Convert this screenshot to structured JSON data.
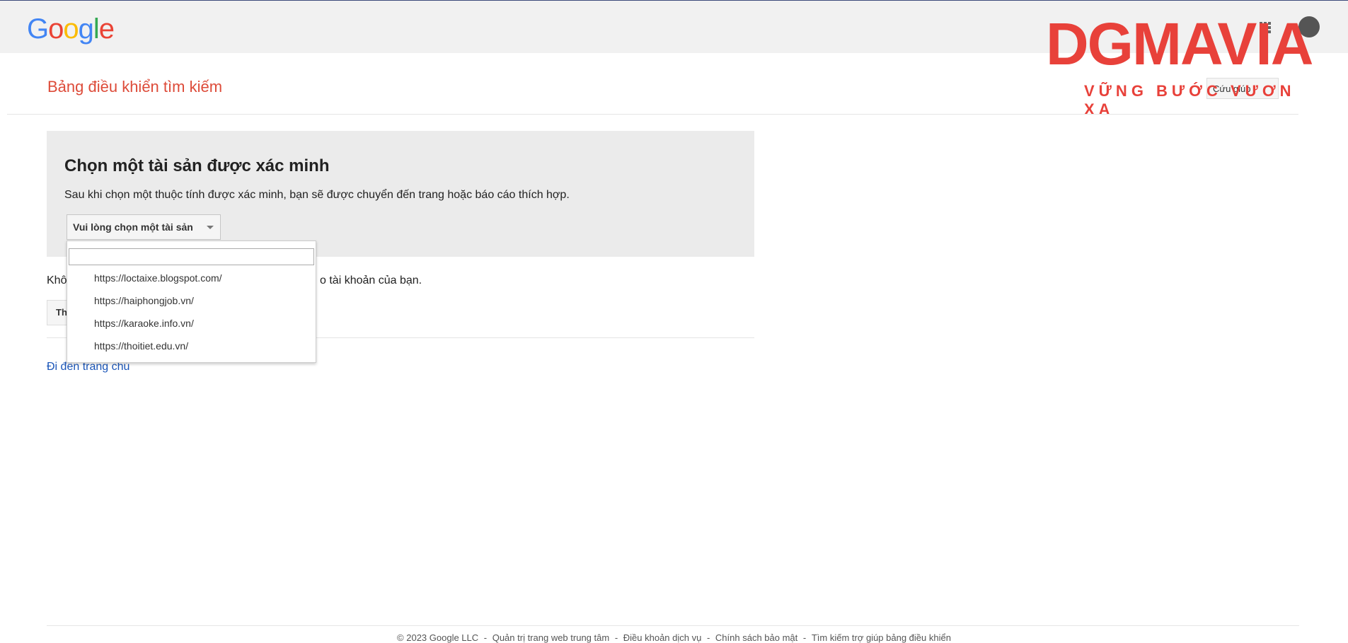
{
  "header": {
    "logo_text": "Google",
    "logo_colors": [
      "#4285F4",
      "#EA4335",
      "#FBBC05",
      "#4285F4",
      "#34A853",
      "#EA4335"
    ]
  },
  "watermark": {
    "main": "DGMAVIA",
    "sub": "VỮNG BƯỚC VƯƠN XA",
    "color": "#e8413a"
  },
  "page": {
    "title": "Bảng điều khiển tìm kiếm",
    "help_label": "Cứu giúp"
  },
  "panel": {
    "title": "Chọn một tài sản được xác minh",
    "description": "Sau khi chọn một thuộc tính được xác minh, bạn sẽ được chuyển đến trang hoặc báo cáo thích hợp.",
    "select_label": "Vui lòng chọn một tài sản"
  },
  "dropdown": {
    "search_value": "",
    "options": [
      "https://loctaixe.blogspot.com/",
      "https://haiphongjob.vn/",
      "https://karaoke.info.vn/",
      "https://thoitiet.edu.vn/"
    ]
  },
  "below": {
    "text_start": "Khô",
    "text_end": "o tài khoản của bạn.",
    "button_label": "Th"
  },
  "home_link": "Đi đến trang chủ",
  "footer": {
    "items": [
      "© 2023 Google LLC",
      "Quản trị trang web trung tâm",
      "Điều khoản dịch vụ",
      "Chính sách bảo mật",
      "Tìm kiếm trợ giúp bảng điều khiển"
    ],
    "separator": " - "
  }
}
